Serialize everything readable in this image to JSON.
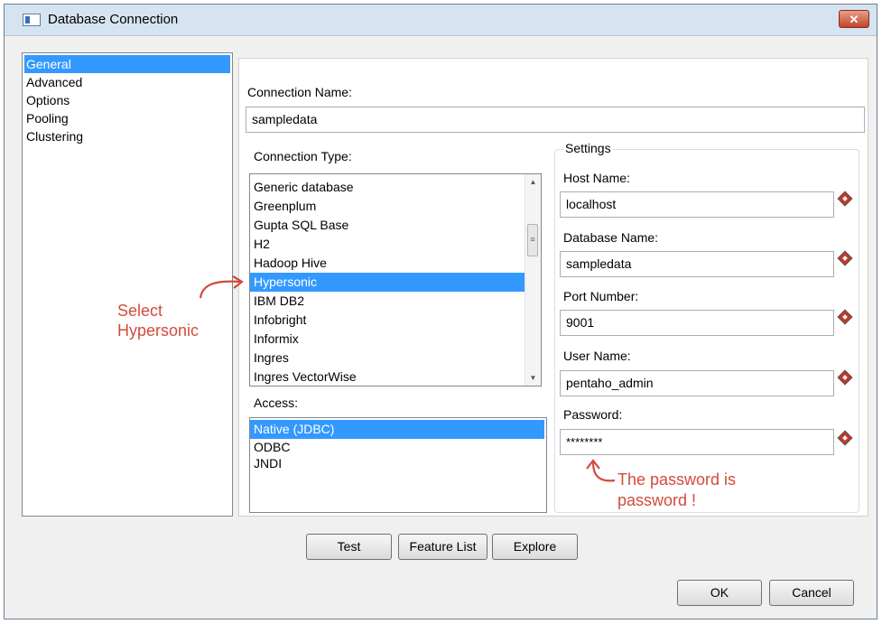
{
  "window": {
    "title": "Database Connection",
    "close_label": "✕"
  },
  "nav": {
    "items": [
      "General",
      "Advanced",
      "Options",
      "Pooling",
      "Clustering"
    ],
    "selected": "General"
  },
  "connection_name": {
    "label": "Connection Name:",
    "value": "sampledata"
  },
  "connection_type": {
    "label": "Connection Type:",
    "items": [
      "Generic database",
      "Greenplum",
      "Gupta SQL Base",
      "H2",
      "Hadoop Hive",
      "Hypersonic",
      "IBM DB2",
      "Infobright",
      "Informix",
      "Ingres",
      "Ingres VectorWise"
    ],
    "selected": "Hypersonic"
  },
  "access": {
    "label": "Access:",
    "items": [
      "Native (JDBC)",
      "ODBC",
      "JNDI"
    ],
    "selected": "Native (JDBC)"
  },
  "settings": {
    "legend": "Settings",
    "host": {
      "label": "Host Name:",
      "value": "localhost"
    },
    "database": {
      "label": "Database Name:",
      "value": "sampledata"
    },
    "port": {
      "label": "Port Number:",
      "value": "9001"
    },
    "user": {
      "label": "User Name:",
      "value": "pentaho_admin"
    },
    "password": {
      "label": "Password:",
      "value": "********"
    }
  },
  "buttons": {
    "test": "Test",
    "feature_list": "Feature List",
    "explore": "Explore",
    "ok": "OK",
    "cancel": "Cancel"
  },
  "annotations": {
    "select_line1": "Select",
    "select_line2": "Hypersonic",
    "password_line1": "The password is",
    "password_line2": "password !"
  },
  "colors": {
    "selection": "#3399ff",
    "annotation": "#d24b3c",
    "close_button": "#c2432a"
  }
}
